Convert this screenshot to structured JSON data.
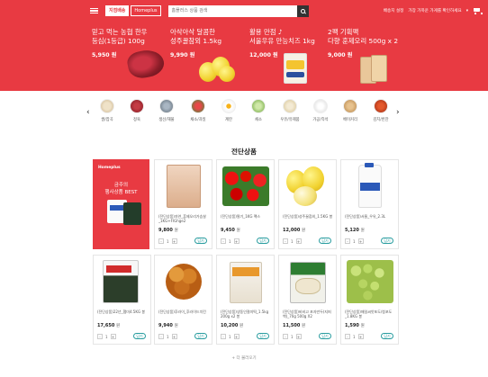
{
  "header": {
    "tabs": [
      "지점배송",
      "Homeplus"
    ],
    "search_placeholder": "홈플러스 상품 검색",
    "delivery_label": "배송지 설정",
    "notice_label": "가장 가까운 가게를 확인하세요",
    "brand_color": "#e83a42"
  },
  "banner": {
    "promos": [
      {
        "title": "믿고 먹는 농협 한우",
        "title2": "등심(1등급) 100g",
        "price": "5,950 원"
      },
      {
        "title": "아삭아삭 달콤한",
        "title2": "성주꿀참외 1.5kg",
        "price": "9,990 원"
      },
      {
        "title": "활용 만점 ♪",
        "title2": "서울우유 만능치즈 1kg",
        "price": "12,000 원"
      },
      {
        "title": "2팩 기획팩",
        "title2": "다향 훈제오리 500g x 2",
        "price": "9,000 원"
      }
    ]
  },
  "categories": [
    {
      "label": "쌀/잡곡",
      "icon": "rice-bowl-icon"
    },
    {
      "label": "정육",
      "icon": "meat-icon"
    },
    {
      "label": "생선/해물",
      "icon": "fish-icon"
    },
    {
      "label": "채소/과일",
      "icon": "vegetable-icon"
    },
    {
      "label": "계란",
      "icon": "egg-icon"
    },
    {
      "label": "채소",
      "icon": "lettuce-icon"
    },
    {
      "label": "우유/유제품",
      "icon": "milk-icon"
    },
    {
      "label": "가공/즉석",
      "icon": "ready-meal-icon"
    },
    {
      "label": "베이커리",
      "icon": "bread-icon"
    },
    {
      "label": "김치/반찬",
      "icon": "kimchi-icon"
    }
  ],
  "section": {
    "title": "전단상품",
    "promo_logo": "Homeplus",
    "promo_heading1": "금주의",
    "promo_heading2": "행사상품 BEST",
    "more_label": "더 불러오기"
  },
  "products": [
    {
      "name": "(전단상품)자연_훈제오리가슴살_1KG+FIGhge2",
      "price": "9,800",
      "icon": "smoked-duck-icon"
    },
    {
      "name": "(전단상품)딸기_1KG 팩스",
      "price": "9,450",
      "icon": "strawberry-icon"
    },
    {
      "name": "(전단상품)성주꿀참외_1.5KG 봉",
      "price": "12,000",
      "icon": "melon-icon"
    },
    {
      "name": "(전단상품)서울_우유_2.3L",
      "price": "5,120",
      "icon": "milk-jug-icon"
    },
    {
      "name": "(전단상품)22년_햅미4.5KG 봉",
      "price": "17,650",
      "icon": "rice-bag-icon"
    },
    {
      "name": "(전단상품)후라이_후라이드치킨",
      "price": "9,940",
      "icon": "fried-chicken-icon"
    },
    {
      "name": "(전단상품)냉동인절미떡_1.5kg 200g x2 봉",
      "price": "10,200",
      "icon": "rice-cake-icon"
    },
    {
      "name": "(전단상품)비비고 포자만두(지퍼백)_70g 500g X2",
      "price": "11,500",
      "icon": "dumpling-icon"
    },
    {
      "name": "(전단상품)매일씨앗포도/청포도_1.8KG 봉",
      "price": "1,590",
      "icon": "grape-icon"
    }
  ],
  "won_label": "원",
  "cart_label": "담기",
  "qty_default": "1"
}
